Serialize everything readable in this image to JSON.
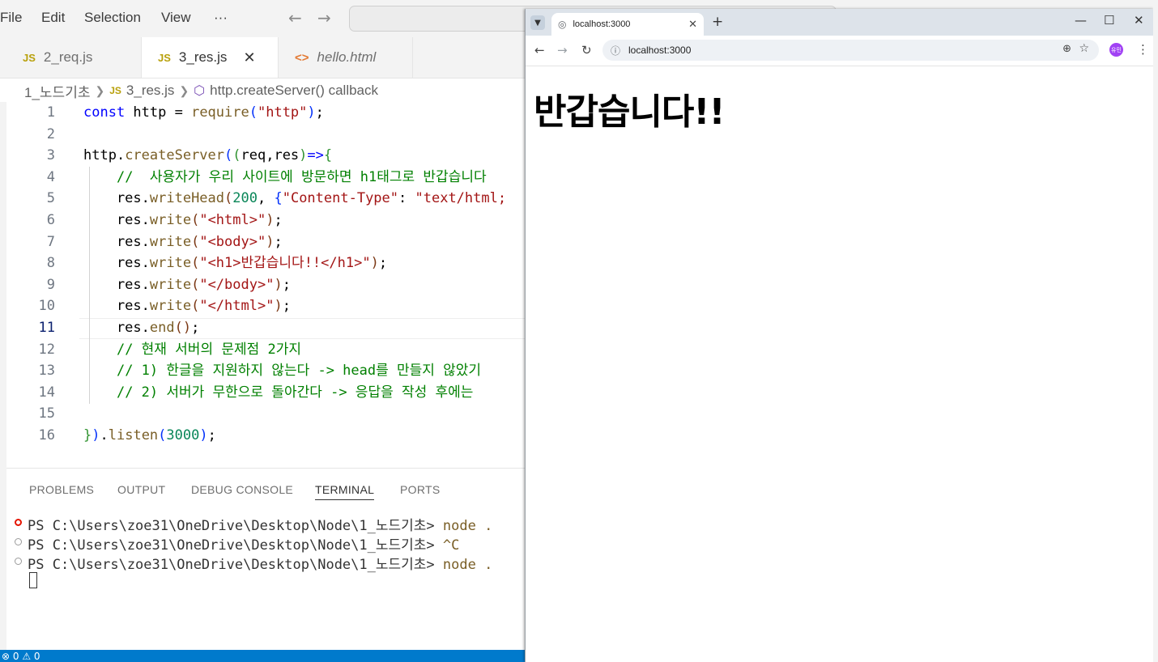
{
  "menubar": {
    "file": "File",
    "edit": "Edit",
    "selection": "Selection",
    "view": "View",
    "more": "···"
  },
  "tabs": [
    {
      "label": "2_req.js",
      "badge": "JS"
    },
    {
      "label": "3_res.js",
      "badge": "JS",
      "close": "✕"
    },
    {
      "label": "hello.html",
      "badge": "<>"
    }
  ],
  "breadcrumb": {
    "folder": "1_노드기초",
    "file_badge": "JS",
    "file": "3_res.js",
    "symbol": "http.createServer() callback"
  },
  "editor": {
    "line_numbers": [
      "1",
      "2",
      "3",
      "4",
      "5",
      "6",
      "7",
      "8",
      "9",
      "10",
      "11",
      "12",
      "13",
      "14",
      "15",
      "16"
    ],
    "current_line": "11"
  },
  "panel": {
    "tabs": [
      "PROBLEMS",
      "OUTPUT",
      "DEBUG CONSOLE",
      "TERMINAL",
      "PORTS"
    ],
    "terminal": [
      {
        "prompt": "PS C:\\Users\\zoe31\\OneDrive\\Desktop\\Node\\1_노드기초> ",
        "cmd": "node ."
      },
      {
        "prompt": "PS C:\\Users\\zoe31\\OneDrive\\Desktop\\Node\\1_노드기초> ",
        "cmd": "^C"
      },
      {
        "prompt": "PS C:\\Users\\zoe31\\OneDrive\\Desktop\\Node\\1_노드기초> ",
        "cmd": "node ."
      }
    ]
  },
  "statusbar": {
    "problems": "⊗ 0 ⚠ 0"
  },
  "browser": {
    "tab_title": "localhost:3000",
    "url": "localhost:3000",
    "avatar_text": "유민",
    "page_heading": "반갑습니다!!"
  },
  "colors": {
    "statusbar": "#007acc",
    "keyword": "#0000ff",
    "string": "#a31515",
    "comment": "#008000"
  }
}
